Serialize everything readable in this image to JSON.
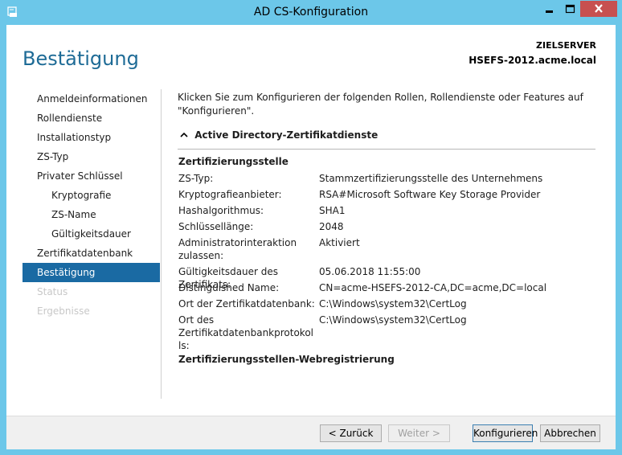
{
  "window": {
    "title": "AD CS-Konfiguration",
    "controls": {
      "minimize": "minimize",
      "maximize": "maximize",
      "close": "close"
    }
  },
  "header": {
    "page_title": "Bestätigung",
    "target_label": "ZIELSERVER",
    "target_value": "HSEFS-2012.acme.local"
  },
  "nav": {
    "items": [
      {
        "label": "Anmeldeinformationen",
        "state": "normal",
        "indent": 0
      },
      {
        "label": "Rollendienste",
        "state": "normal",
        "indent": 0
      },
      {
        "label": "Installationstyp",
        "state": "normal",
        "indent": 0
      },
      {
        "label": "ZS-Typ",
        "state": "normal",
        "indent": 0
      },
      {
        "label": "Privater Schlüssel",
        "state": "normal",
        "indent": 0
      },
      {
        "label": "Kryptografie",
        "state": "normal",
        "indent": 1
      },
      {
        "label": "ZS-Name",
        "state": "normal",
        "indent": 1
      },
      {
        "label": "Gültigkeitsdauer",
        "state": "normal",
        "indent": 1
      },
      {
        "label": "Zertifikatdatenbank",
        "state": "normal",
        "indent": 0
      },
      {
        "label": "Bestätigung",
        "state": "active",
        "indent": 0
      },
      {
        "label": "Status",
        "state": "disabled",
        "indent": 0
      },
      {
        "label": "Ergebnisse",
        "state": "disabled",
        "indent": 0
      }
    ]
  },
  "content": {
    "intro": "Klicken Sie zum Konfigurieren der folgenden Rollen, Rollendienste oder Features auf \"Konfigurieren\".",
    "section_title": "Active Directory-Zertifikatdienste",
    "group1_title": "Zertifizierungsstelle",
    "rows": [
      {
        "label": "ZS-Typ:",
        "value": "Stammzertifizierungsstelle des Unternehmens"
      },
      {
        "label": "Kryptografieanbieter:",
        "value": "RSA#Microsoft Software Key Storage Provider"
      },
      {
        "label": "Hashalgorithmus:",
        "value": "SHA1"
      },
      {
        "label": "Schlüssellänge:",
        "value": "2048"
      },
      {
        "label": "Administratorinteraktion zulassen:",
        "value": "Aktiviert"
      },
      {
        "label": "Gültigkeitsdauer des Zertifikats:",
        "value": "05.06.2018 11:55:00"
      },
      {
        "label": "Distinguished Name:",
        "value": "CN=acme-HSEFS-2012-CA,DC=acme,DC=local"
      },
      {
        "label": "Ort der Zertifikatdatenbank:",
        "value": "C:\\Windows\\system32\\CertLog"
      },
      {
        "label": "Ort des Zertifikatdatenbankprotokolls:",
        "value": "C:\\Windows\\system32\\CertLog"
      }
    ],
    "group2_title": "Zertifizierungsstellen-Webregistrierung"
  },
  "footer": {
    "back": "< Zurück",
    "next": "Weiter >",
    "configure": "Konfigurieren",
    "cancel": "Abbrechen"
  },
  "colors": {
    "title_bar": "#6cc7e9",
    "accent": "#1a6aa3",
    "heading": "#1e6b96",
    "close": "#c75050"
  }
}
